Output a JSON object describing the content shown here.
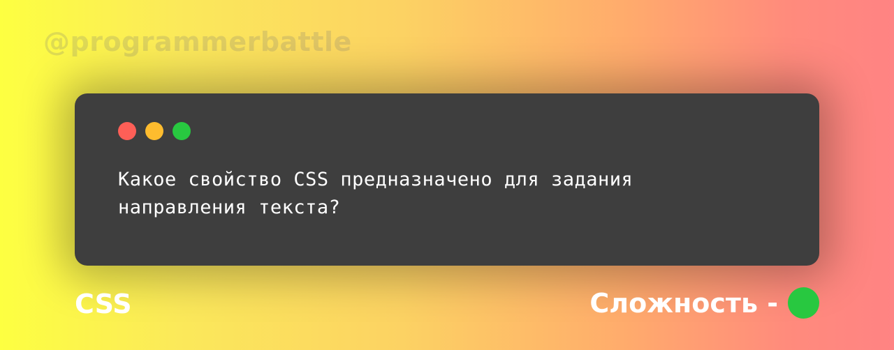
{
  "watermark": "@programmerbattle",
  "window": {
    "dots": [
      {
        "name": "close",
        "color": "#fe5f57"
      },
      {
        "name": "minimize",
        "color": "#febc2e"
      },
      {
        "name": "maximize",
        "color": "#28c840"
      }
    ],
    "question": "Какое свойство CSS предназначено для задания направления текста?"
  },
  "footer": {
    "topic": "CSS",
    "difficulty_label": "Сложность -",
    "difficulty_color": "#28c840"
  }
}
